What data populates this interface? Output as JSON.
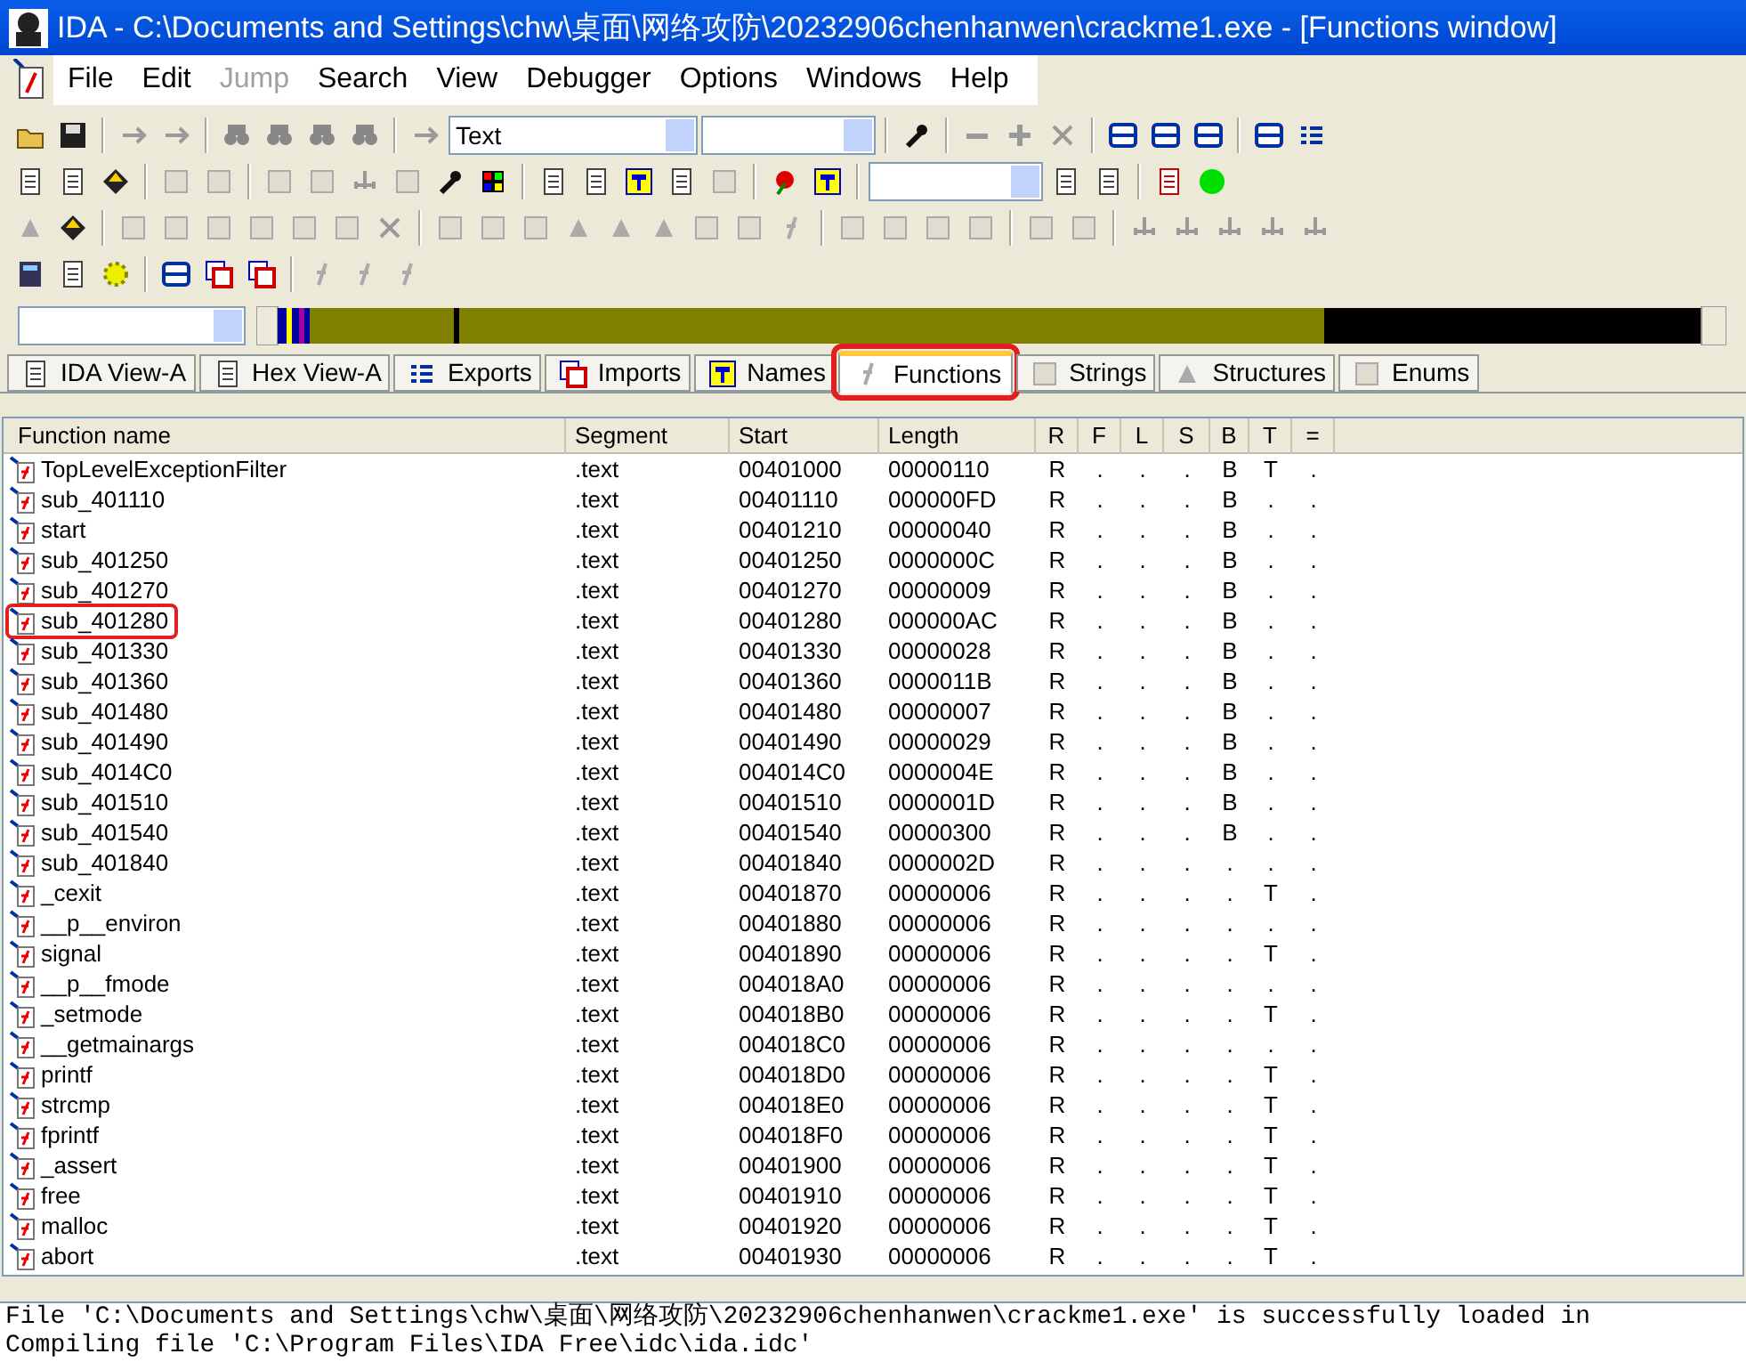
{
  "window": {
    "title": "IDA - C:\\Documents and Settings\\chw\\桌面\\网络攻防\\20232906chenhanwen\\crackme1.exe - [Functions window]"
  },
  "menu": [
    {
      "label": "File",
      "disabled": false
    },
    {
      "label": "Edit",
      "disabled": false
    },
    {
      "label": "Jump",
      "disabled": true
    },
    {
      "label": "Search",
      "disabled": false
    },
    {
      "label": "View",
      "disabled": false
    },
    {
      "label": "Debugger",
      "disabled": false
    },
    {
      "label": "Options",
      "disabled": false
    },
    {
      "label": "Windows",
      "disabled": false
    },
    {
      "label": "Help",
      "disabled": false
    }
  ],
  "toolbar": {
    "display_combo": "Text"
  },
  "tabs": [
    {
      "label": "IDA View-A",
      "selected": false,
      "highlighted": false
    },
    {
      "label": "Hex View-A",
      "selected": false,
      "highlighted": false
    },
    {
      "label": "Exports",
      "selected": false,
      "highlighted": false
    },
    {
      "label": "Imports",
      "selected": false,
      "highlighted": false
    },
    {
      "label": "Names",
      "selected": false,
      "highlighted": false
    },
    {
      "label": "Functions",
      "selected": true,
      "highlighted": true
    },
    {
      "label": "Strings",
      "selected": false,
      "highlighted": false
    },
    {
      "label": "Structures",
      "selected": false,
      "highlighted": false
    },
    {
      "label": "Enums",
      "selected": false,
      "highlighted": false
    }
  ],
  "table": {
    "columns": [
      "Function name",
      "Segment",
      "Start",
      "Length",
      "R",
      "F",
      "L",
      "S",
      "B",
      "T",
      "="
    ],
    "rows": [
      {
        "name": "TopLevelExceptionFilter",
        "segment": ".text",
        "start": "00401000",
        "length": "00000110",
        "flags": [
          "R",
          ".",
          ".",
          ".",
          "B",
          "T",
          "."
        ],
        "highlighted": false
      },
      {
        "name": "sub_401110",
        "segment": ".text",
        "start": "00401110",
        "length": "000000FD",
        "flags": [
          "R",
          ".",
          ".",
          ".",
          "B",
          ".",
          "."
        ],
        "highlighted": false
      },
      {
        "name": "start",
        "segment": ".text",
        "start": "00401210",
        "length": "00000040",
        "flags": [
          "R",
          ".",
          ".",
          ".",
          "B",
          ".",
          "."
        ],
        "highlighted": false
      },
      {
        "name": "sub_401250",
        "segment": ".text",
        "start": "00401250",
        "length": "0000000C",
        "flags": [
          "R",
          ".",
          ".",
          ".",
          "B",
          ".",
          "."
        ],
        "highlighted": false
      },
      {
        "name": "sub_401270",
        "segment": ".text",
        "start": "00401270",
        "length": "00000009",
        "flags": [
          "R",
          ".",
          ".",
          ".",
          "B",
          ".",
          "."
        ],
        "highlighted": false
      },
      {
        "name": "sub_401280",
        "segment": ".text",
        "start": "00401280",
        "length": "000000AC",
        "flags": [
          "R",
          ".",
          ".",
          ".",
          "B",
          ".",
          "."
        ],
        "highlighted": true
      },
      {
        "name": "sub_401330",
        "segment": ".text",
        "start": "00401330",
        "length": "00000028",
        "flags": [
          "R",
          ".",
          ".",
          ".",
          "B",
          ".",
          "."
        ],
        "highlighted": false
      },
      {
        "name": "sub_401360",
        "segment": ".text",
        "start": "00401360",
        "length": "0000011B",
        "flags": [
          "R",
          ".",
          ".",
          ".",
          "B",
          ".",
          "."
        ],
        "highlighted": false
      },
      {
        "name": "sub_401480",
        "segment": ".text",
        "start": "00401480",
        "length": "00000007",
        "flags": [
          "R",
          ".",
          ".",
          ".",
          "B",
          ".",
          "."
        ],
        "highlighted": false
      },
      {
        "name": "sub_401490",
        "segment": ".text",
        "start": "00401490",
        "length": "00000029",
        "flags": [
          "R",
          ".",
          ".",
          ".",
          "B",
          ".",
          "."
        ],
        "highlighted": false
      },
      {
        "name": "sub_4014C0",
        "segment": ".text",
        "start": "004014C0",
        "length": "0000004E",
        "flags": [
          "R",
          ".",
          ".",
          ".",
          "B",
          ".",
          "."
        ],
        "highlighted": false
      },
      {
        "name": "sub_401510",
        "segment": ".text",
        "start": "00401510",
        "length": "0000001D",
        "flags": [
          "R",
          ".",
          ".",
          ".",
          "B",
          ".",
          "."
        ],
        "highlighted": false
      },
      {
        "name": "sub_401540",
        "segment": ".text",
        "start": "00401540",
        "length": "00000300",
        "flags": [
          "R",
          ".",
          ".",
          ".",
          "B",
          ".",
          "."
        ],
        "highlighted": false
      },
      {
        "name": "sub_401840",
        "segment": ".text",
        "start": "00401840",
        "length": "0000002D",
        "flags": [
          "R",
          ".",
          ".",
          ".",
          ".",
          ".",
          "."
        ],
        "highlighted": false
      },
      {
        "name": "_cexit",
        "segment": ".text",
        "start": "00401870",
        "length": "00000006",
        "flags": [
          "R",
          ".",
          ".",
          ".",
          ".",
          "T",
          "."
        ],
        "highlighted": false
      },
      {
        "name": "__p__environ",
        "segment": ".text",
        "start": "00401880",
        "length": "00000006",
        "flags": [
          "R",
          ".",
          ".",
          ".",
          ".",
          ".",
          "."
        ],
        "highlighted": false
      },
      {
        "name": "signal",
        "segment": ".text",
        "start": "00401890",
        "length": "00000006",
        "flags": [
          "R",
          ".",
          ".",
          ".",
          ".",
          "T",
          "."
        ],
        "highlighted": false
      },
      {
        "name": "__p__fmode",
        "segment": ".text",
        "start": "004018A0",
        "length": "00000006",
        "flags": [
          "R",
          ".",
          ".",
          ".",
          ".",
          ".",
          "."
        ],
        "highlighted": false
      },
      {
        "name": "_setmode",
        "segment": ".text",
        "start": "004018B0",
        "length": "00000006",
        "flags": [
          "R",
          ".",
          ".",
          ".",
          ".",
          "T",
          "."
        ],
        "highlighted": false
      },
      {
        "name": "__getmainargs",
        "segment": ".text",
        "start": "004018C0",
        "length": "00000006",
        "flags": [
          "R",
          ".",
          ".",
          ".",
          ".",
          ".",
          "."
        ],
        "highlighted": false
      },
      {
        "name": "printf",
        "segment": ".text",
        "start": "004018D0",
        "length": "00000006",
        "flags": [
          "R",
          ".",
          ".",
          ".",
          ".",
          "T",
          "."
        ],
        "highlighted": false
      },
      {
        "name": "strcmp",
        "segment": ".text",
        "start": "004018E0",
        "length": "00000006",
        "flags": [
          "R",
          ".",
          ".",
          ".",
          ".",
          "T",
          "."
        ],
        "highlighted": false
      },
      {
        "name": "fprintf",
        "segment": ".text",
        "start": "004018F0",
        "length": "00000006",
        "flags": [
          "R",
          ".",
          ".",
          ".",
          ".",
          "T",
          "."
        ],
        "highlighted": false
      },
      {
        "name": "_assert",
        "segment": ".text",
        "start": "00401900",
        "length": "00000006",
        "flags": [
          "R",
          ".",
          ".",
          ".",
          ".",
          "T",
          "."
        ],
        "highlighted": false
      },
      {
        "name": "free",
        "segment": ".text",
        "start": "00401910",
        "length": "00000006",
        "flags": [
          "R",
          ".",
          ".",
          ".",
          ".",
          "T",
          "."
        ],
        "highlighted": false
      },
      {
        "name": "malloc",
        "segment": ".text",
        "start": "00401920",
        "length": "00000006",
        "flags": [
          "R",
          ".",
          ".",
          ".",
          ".",
          "T",
          "."
        ],
        "highlighted": false
      },
      {
        "name": "abort",
        "segment": ".text",
        "start": "00401930",
        "length": "00000006",
        "flags": [
          "R",
          ".",
          ".",
          ".",
          ".",
          "T",
          "."
        ],
        "highlighted": false
      }
    ]
  },
  "output": [
    "File 'C:\\Documents and Settings\\chw\\桌面\\网络攻防\\20232906chenhanwen\\crackme1.exe' is successfully loaded in",
    "Compiling file 'C:\\Program Files\\IDA Free\\idc\\ida.idc'"
  ]
}
